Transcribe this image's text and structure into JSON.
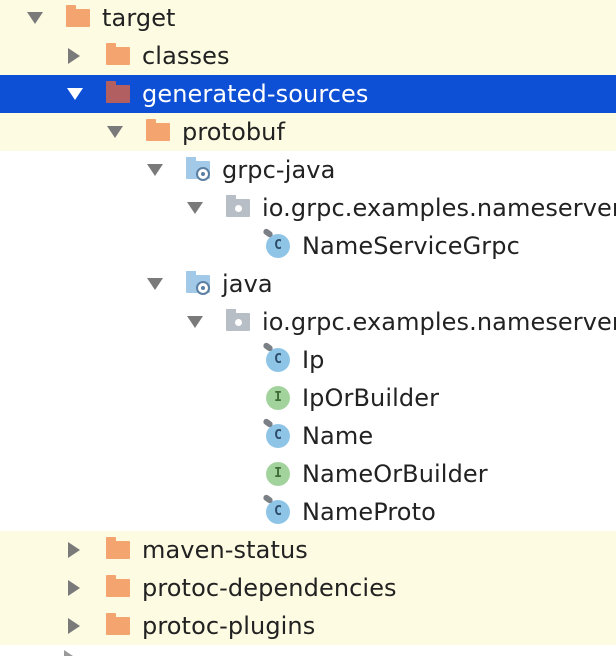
{
  "tree": {
    "target": {
      "label": "target"
    },
    "classes": {
      "label": "classes"
    },
    "generated_sources": {
      "label": "generated-sources"
    },
    "protobuf": {
      "label": "protobuf"
    },
    "grpc_java": {
      "label": "grpc-java"
    },
    "pkg1": {
      "label": "io.grpc.examples.nameserver"
    },
    "name_service_grpc": {
      "label": "NameServiceGrpc",
      "badge": "C"
    },
    "java": {
      "label": "java"
    },
    "pkg2": {
      "label": "io.grpc.examples.nameserver"
    },
    "ip": {
      "label": "Ip",
      "badge": "C"
    },
    "ip_or_builder": {
      "label": "IpOrBuilder",
      "badge": "I"
    },
    "name": {
      "label": "Name",
      "badge": "C"
    },
    "name_or_builder": {
      "label": "NameOrBuilder",
      "badge": "I"
    },
    "name_proto": {
      "label": "NameProto",
      "badge": "C"
    },
    "maven_status": {
      "label": "maven-status"
    },
    "protoc_dependencies": {
      "label": "protoc-dependencies"
    },
    "protoc_plugins": {
      "label": "protoc-plugins"
    }
  },
  "colors": {
    "selection": "#0d4fd5",
    "excluded_background": "#fdfbe2",
    "folder": "#f4a46e",
    "class_icon": "#8ec5e6",
    "interface_icon": "#a3d39c"
  }
}
